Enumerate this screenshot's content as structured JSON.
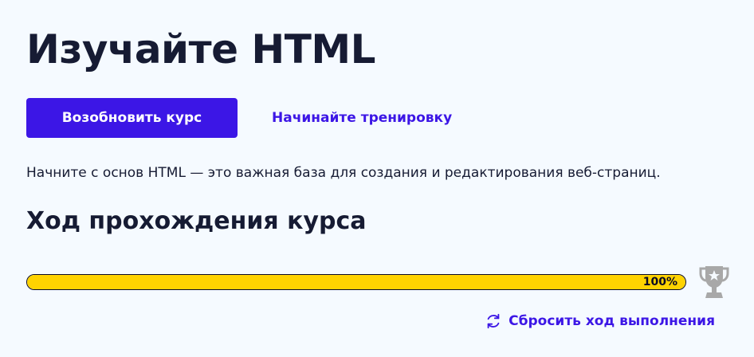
{
  "page": {
    "title": "Изучайте HTML",
    "description": "Начните с основ HTML — это важная база для создания и редактирования веб-страниц."
  },
  "actions": {
    "resume_label": "Возобновить курс",
    "practice_label": "Начинайте тренировку"
  },
  "progress": {
    "heading": "Ход прохождения курса",
    "percent": 100,
    "label": "100%",
    "trophy_icon": "trophy-icon"
  },
  "reset": {
    "label": "Сбросить ход выполнения",
    "icon": "refresh-icon"
  },
  "colors": {
    "accent": "#3c16e6",
    "progress_fill": "#ffd300",
    "background": "#f5faff",
    "text": "#161b33",
    "trophy": "#a8a8a8"
  }
}
